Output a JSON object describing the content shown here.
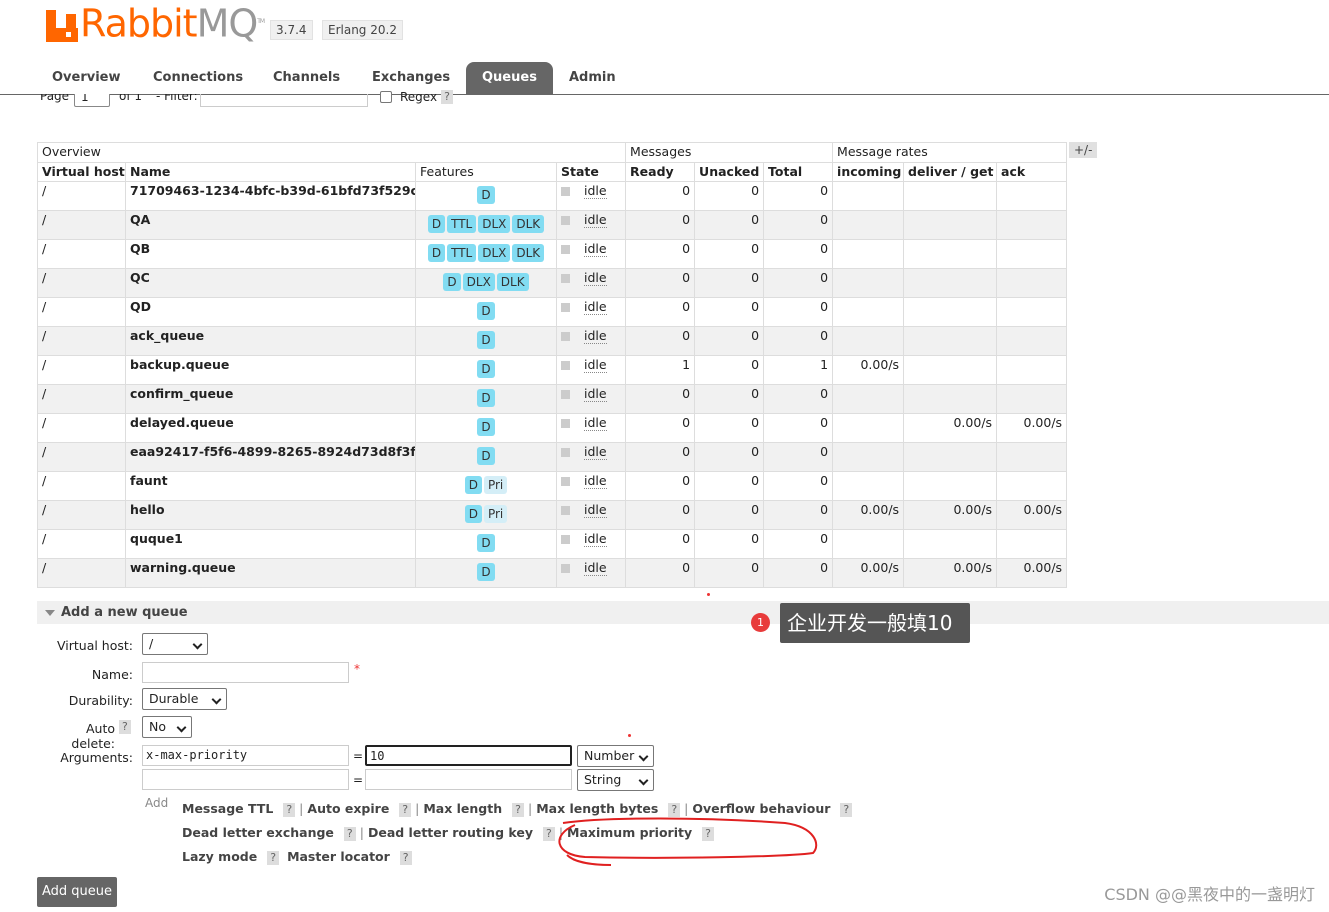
{
  "header": {
    "logo_text_a": "Rabbit",
    "logo_text_b": "MQ",
    "logo_tm": "TM",
    "version": "3.7.4",
    "erlang": "Erlang 20.2"
  },
  "tabs": [
    {
      "label": "Overview",
      "active": false
    },
    {
      "label": "Connections",
      "active": false
    },
    {
      "label": "Channels",
      "active": false
    },
    {
      "label": "Exchanges",
      "active": false
    },
    {
      "label": "Queues",
      "active": true
    },
    {
      "label": "Admin",
      "active": false
    }
  ],
  "pager": {
    "page_label": "Page",
    "page_value": "1",
    "of_label": "of 1",
    "filter_label": "- Filter:",
    "filter_value": "",
    "regex_label": "Regex",
    "help": "?"
  },
  "table": {
    "groups": [
      "Overview",
      "Messages",
      "Message rates"
    ],
    "columns": [
      "Virtual host",
      "Name",
      "Features",
      "State",
      "Ready",
      "Unacked",
      "Total",
      "incoming",
      "deliver / get",
      "ack"
    ],
    "toggle": "+/-",
    "rows": [
      {
        "vhost": "/",
        "name": "71709463-1234-4bfc-b39d-61bfd73f529c",
        "features": [
          "D"
        ],
        "state": "idle",
        "ready": "0",
        "unacked": "0",
        "total": "0",
        "incoming": "",
        "deliver": "",
        "ack": ""
      },
      {
        "vhost": "/",
        "name": "QA",
        "features": [
          "D",
          "TTL",
          "DLX",
          "DLK"
        ],
        "state": "idle",
        "ready": "0",
        "unacked": "0",
        "total": "0",
        "incoming": "",
        "deliver": "",
        "ack": ""
      },
      {
        "vhost": "/",
        "name": "QB",
        "features": [
          "D",
          "TTL",
          "DLX",
          "DLK"
        ],
        "state": "idle",
        "ready": "0",
        "unacked": "0",
        "total": "0",
        "incoming": "",
        "deliver": "",
        "ack": ""
      },
      {
        "vhost": "/",
        "name": "QC",
        "features": [
          "D",
          "DLX",
          "DLK"
        ],
        "state": "idle",
        "ready": "0",
        "unacked": "0",
        "total": "0",
        "incoming": "",
        "deliver": "",
        "ack": ""
      },
      {
        "vhost": "/",
        "name": "QD",
        "features": [
          "D"
        ],
        "state": "idle",
        "ready": "0",
        "unacked": "0",
        "total": "0",
        "incoming": "",
        "deliver": "",
        "ack": ""
      },
      {
        "vhost": "/",
        "name": "ack_queue",
        "features": [
          "D"
        ],
        "state": "idle",
        "ready": "0",
        "unacked": "0",
        "total": "0",
        "incoming": "",
        "deliver": "",
        "ack": ""
      },
      {
        "vhost": "/",
        "name": "backup.queue",
        "features": [
          "D"
        ],
        "state": "idle",
        "ready": "1",
        "unacked": "0",
        "total": "1",
        "incoming": "0.00/s",
        "deliver": "",
        "ack": ""
      },
      {
        "vhost": "/",
        "name": "confirm_queue",
        "features": [
          "D"
        ],
        "state": "idle",
        "ready": "0",
        "unacked": "0",
        "total": "0",
        "incoming": "",
        "deliver": "",
        "ack": ""
      },
      {
        "vhost": "/",
        "name": "delayed.queue",
        "features": [
          "D"
        ],
        "state": "idle",
        "ready": "0",
        "unacked": "0",
        "total": "0",
        "incoming": "",
        "deliver": "0.00/s",
        "ack": "0.00/s"
      },
      {
        "vhost": "/",
        "name": "eaa92417-f5f6-4899-8265-8924d73d8f3f",
        "features": [
          "D"
        ],
        "state": "idle",
        "ready": "0",
        "unacked": "0",
        "total": "0",
        "incoming": "",
        "deliver": "",
        "ack": ""
      },
      {
        "vhost": "/",
        "name": "faunt",
        "features": [
          "D",
          "Pri"
        ],
        "state": "idle",
        "ready": "0",
        "unacked": "0",
        "total": "0",
        "incoming": "",
        "deliver": "",
        "ack": ""
      },
      {
        "vhost": "/",
        "name": "hello",
        "features": [
          "D",
          "Pri"
        ],
        "state": "idle",
        "ready": "0",
        "unacked": "0",
        "total": "0",
        "incoming": "0.00/s",
        "deliver": "0.00/s",
        "ack": "0.00/s"
      },
      {
        "vhost": "/",
        "name": "ququе1",
        "features": [
          "D"
        ],
        "state": "idle",
        "ready": "0",
        "unacked": "0",
        "total": "0",
        "incoming": "",
        "deliver": "",
        "ack": ""
      },
      {
        "vhost": "/",
        "name": "warning.queue",
        "features": [
          "D"
        ],
        "state": "idle",
        "ready": "0",
        "unacked": "0",
        "total": "0",
        "incoming": "0.00/s",
        "deliver": "0.00/s",
        "ack": "0.00/s"
      }
    ]
  },
  "add_queue": {
    "title": "Add a new queue",
    "vhost_label": "Virtual host:",
    "vhost_value": "/",
    "name_label": "Name:",
    "name_value": "",
    "required": "*",
    "durability_label": "Durability:",
    "durability_value": "Durable",
    "auto_delete_label": "Auto delete:",
    "auto_delete_value": "No",
    "help": "?",
    "arguments_label": "Arguments:",
    "arg1_key": "x-max-priority",
    "arg1_value": "10",
    "arg1_type": "Number",
    "arg2_key": "",
    "arg2_value": "",
    "arg2_type": "String",
    "eq": "=",
    "add_word": "Add",
    "links_row1": [
      "Message TTL",
      "Auto expire",
      "Max length",
      "Max length bytes",
      "Overflow behaviour"
    ],
    "links_row2": [
      "Dead letter exchange",
      "Dead letter routing key",
      "Maximum priority"
    ],
    "links_row3": [
      "Lazy mode",
      "Master locator"
    ],
    "separator": "|",
    "submit_label": "Add queue"
  },
  "annotation": {
    "number": "1",
    "text": "企业开发一般填10"
  },
  "watermark": "CSDN @@黑夜中的一盏明灯",
  "colors": {
    "brand": "#ff6600",
    "tab_active": "#666666",
    "badge": "#82dcf2",
    "annotation_red": "#e33333"
  }
}
